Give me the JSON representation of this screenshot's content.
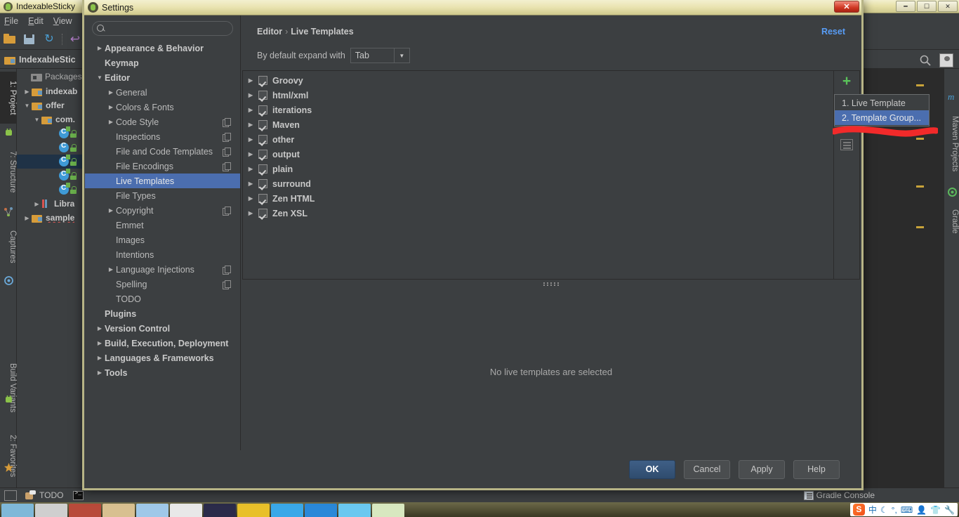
{
  "ide": {
    "window_title": "IndexableSticky",
    "menubar": [
      "File",
      "Edit",
      "View"
    ],
    "toolbar_icons": [
      "open-folder-icon",
      "save-icon",
      "sync-icon",
      "undo-icon"
    ],
    "breadcrumb": "IndexableStic",
    "left_tabs": [
      {
        "label": "1: Project",
        "icon": "android-icon",
        "active": true
      },
      {
        "label": "7: Structure",
        "icon": "structure-icon",
        "active": false
      },
      {
        "label": "Captures",
        "icon": "captures-icon",
        "active": false
      },
      {
        "label": "Build Variants",
        "icon": "android-icon",
        "active": false
      },
      {
        "label": "2: Favorites",
        "icon": "star-icon",
        "active": false
      }
    ],
    "right_tabs": [
      {
        "label": "Maven Projects",
        "icon": "maven-icon"
      },
      {
        "label": "Gradle",
        "icon": "gradle-icon"
      }
    ],
    "project": {
      "header": "Packages",
      "nodes": [
        {
          "label": "indexab",
          "type": "folder",
          "arrow": "collapsed",
          "indent": 0
        },
        {
          "label": "offer",
          "type": "folder",
          "arrow": "expanded",
          "indent": 0
        },
        {
          "label": "com.",
          "type": "package",
          "arrow": "expanded",
          "indent": 1
        },
        {
          "label": "",
          "type": "class-run",
          "arrow": "none",
          "indent": 2
        },
        {
          "label": "",
          "type": "class",
          "arrow": "none",
          "indent": 2
        },
        {
          "label": "",
          "type": "class-run",
          "arrow": "none",
          "indent": 2,
          "selected": true
        },
        {
          "label": "",
          "type": "class-run",
          "arrow": "none",
          "indent": 2
        },
        {
          "label": "",
          "type": "class-run",
          "arrow": "none",
          "indent": 2
        },
        {
          "label": "Libra",
          "type": "library",
          "arrow": "collapsed",
          "indent": 1
        },
        {
          "label": "sample",
          "type": "folder",
          "arrow": "collapsed",
          "indent": 0
        }
      ]
    },
    "status_bar": {
      "todo": "TODO",
      "gradle_console": "Gradle Console"
    },
    "tray": {
      "ime": "中",
      "icons": [
        "sogou-icon",
        "ime-chinese-icon",
        "moon-icon",
        "punctuation-icon",
        "keyboard-icon",
        "user-icon",
        "skin-icon",
        "wrench-icon"
      ]
    }
  },
  "dialog": {
    "title": "Settings",
    "close_label": "✕",
    "search": {
      "value": "",
      "placeholder": ""
    },
    "sidebar": [
      {
        "label": "Appearance & Behavior",
        "arrow": "collapsed",
        "indent": 0,
        "bold": true,
        "copy": false
      },
      {
        "label": "Keymap",
        "arrow": "none",
        "indent": 0,
        "bold": true,
        "copy": false
      },
      {
        "label": "Editor",
        "arrow": "expanded",
        "indent": 0,
        "bold": true,
        "copy": false
      },
      {
        "label": "General",
        "arrow": "collapsed",
        "indent": 1,
        "bold": false,
        "copy": false
      },
      {
        "label": "Colors & Fonts",
        "arrow": "collapsed",
        "indent": 1,
        "bold": false,
        "copy": false
      },
      {
        "label": "Code Style",
        "arrow": "collapsed",
        "indent": 1,
        "bold": false,
        "copy": true
      },
      {
        "label": "Inspections",
        "arrow": "none",
        "indent": 1,
        "bold": false,
        "copy": true
      },
      {
        "label": "File and Code Templates",
        "arrow": "none",
        "indent": 1,
        "bold": false,
        "copy": true
      },
      {
        "label": "File Encodings",
        "arrow": "none",
        "indent": 1,
        "bold": false,
        "copy": true
      },
      {
        "label": "Live Templates",
        "arrow": "none",
        "indent": 1,
        "bold": false,
        "copy": false,
        "selected": true
      },
      {
        "label": "File Types",
        "arrow": "none",
        "indent": 1,
        "bold": false,
        "copy": false
      },
      {
        "label": "Copyright",
        "arrow": "collapsed",
        "indent": 1,
        "bold": false,
        "copy": true
      },
      {
        "label": "Emmet",
        "arrow": "none",
        "indent": 1,
        "bold": false,
        "copy": false
      },
      {
        "label": "Images",
        "arrow": "none",
        "indent": 1,
        "bold": false,
        "copy": false
      },
      {
        "label": "Intentions",
        "arrow": "none",
        "indent": 1,
        "bold": false,
        "copy": false
      },
      {
        "label": "Language Injections",
        "arrow": "collapsed",
        "indent": 1,
        "bold": false,
        "copy": true
      },
      {
        "label": "Spelling",
        "arrow": "none",
        "indent": 1,
        "bold": false,
        "copy": true
      },
      {
        "label": "TODO",
        "arrow": "none",
        "indent": 1,
        "bold": false,
        "copy": false
      },
      {
        "label": "Plugins",
        "arrow": "none",
        "indent": 0,
        "bold": true,
        "copy": false
      },
      {
        "label": "Version Control",
        "arrow": "collapsed",
        "indent": 0,
        "bold": true,
        "copy": false
      },
      {
        "label": "Build, Execution, Deployment",
        "arrow": "collapsed",
        "indent": 0,
        "bold": true,
        "copy": false
      },
      {
        "label": "Languages & Frameworks",
        "arrow": "collapsed",
        "indent": 0,
        "bold": true,
        "copy": false
      },
      {
        "label": "Tools",
        "arrow": "collapsed",
        "indent": 0,
        "bold": true,
        "copy": false
      }
    ],
    "main": {
      "breadcrumb_parent": "Editor",
      "breadcrumb_separator": "›",
      "breadcrumb_current": "Live Templates",
      "reset_label": "Reset",
      "expand_label": "By default expand with",
      "expand_value": "Tab",
      "template_groups": [
        {
          "name": "Groovy",
          "checked": true
        },
        {
          "name": "html/xml",
          "checked": true
        },
        {
          "name": "iterations",
          "checked": true
        },
        {
          "name": "Maven",
          "checked": true
        },
        {
          "name": "other",
          "checked": true
        },
        {
          "name": "output",
          "checked": true
        },
        {
          "name": "plain",
          "checked": true
        },
        {
          "name": "surround",
          "checked": true
        },
        {
          "name": "Zen HTML",
          "checked": true
        },
        {
          "name": "Zen XSL",
          "checked": true
        }
      ],
      "add_button_label": "+",
      "empty_message": "No live templates are selected"
    },
    "footer": {
      "ok": "OK",
      "cancel": "Cancel",
      "apply": "Apply",
      "help": "Help"
    },
    "popup_menu": {
      "items": [
        {
          "label": "1. Live Template",
          "highlighted": false
        },
        {
          "label": "2. Template Group...",
          "highlighted": true
        }
      ]
    }
  },
  "colors": {
    "dialog_bg": "#3c3f41",
    "selection_blue": "#4b6eaf",
    "link_blue": "#589df6",
    "accent_green": "#5ac35a",
    "annotation_red": "#f22a2a",
    "titlebar_yellow": "#e9e3b0"
  }
}
